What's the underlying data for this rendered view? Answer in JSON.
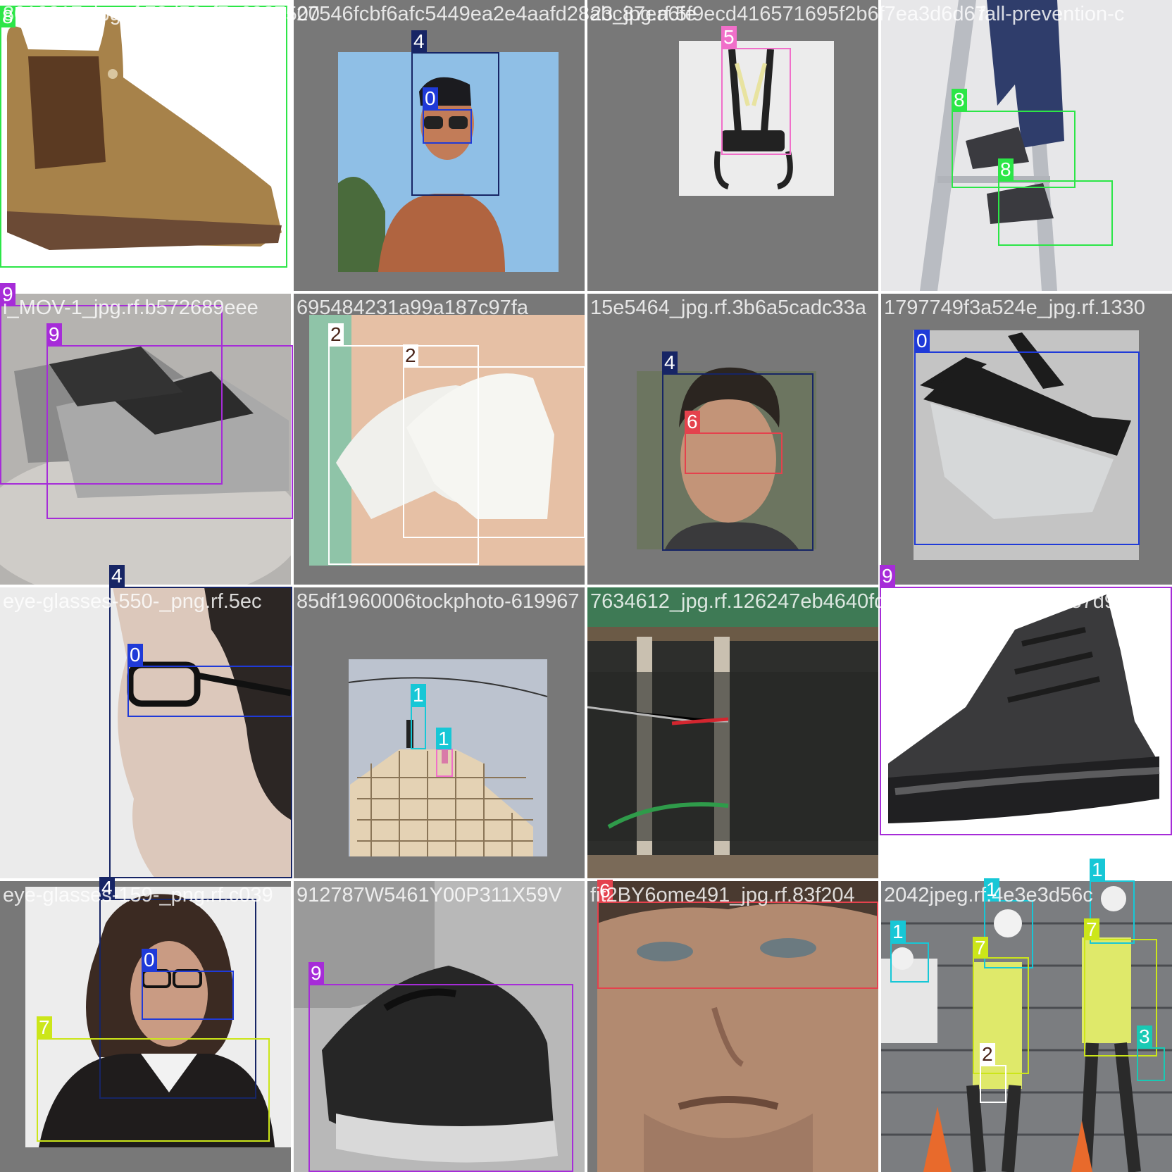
{
  "colors": {
    "0": "#1f3ad8",
    "1": "#17c7d6",
    "2": "#ffffff",
    "3": "#19c9b4",
    "4": "#172565",
    "5": "#f06fc9",
    "6": "#e4424d",
    "7": "#cce619",
    "8": "#2ce647",
    "9": "#a62cd8"
  },
  "tiles": [
    {
      "filename": "8010817_jpg.rf.72d56cf7e6927500",
      "subject": "brown-chelsea-boot",
      "boxes": [
        {
          "cls": "8"
        }
      ]
    },
    {
      "filename": "27546fcbf6afc5449ea2e4aafd28abc87ea6fe",
      "subject": "man-with-sunglasses",
      "boxes": [
        {
          "cls": "4"
        },
        {
          "cls": "0"
        }
      ]
    },
    {
      "filename": "23_jpg.rf.5f9ecd416571695f2b6f7ea3d6d67",
      "subject": "safety-harness",
      "boxes": [
        {
          "cls": "5"
        }
      ]
    },
    {
      "filename": "fall-prevention-c",
      "subject": "worker-on-ladder",
      "boxes": [
        {
          "cls": "8"
        },
        {
          "cls": "8"
        }
      ]
    },
    {
      "filename": "i_MOV-1_jpg.rf.b572689eee",
      "subject": "grey-sneakers",
      "boxes": [
        {
          "cls": "9"
        },
        {
          "cls": "9"
        }
      ]
    },
    {
      "filename": "695484231a99a187c97fa",
      "subject": "white-gloves",
      "boxes": [
        {
          "cls": "2"
        },
        {
          "cls": "2"
        }
      ]
    },
    {
      "filename": "15e5464_jpg.rf.3b6a5cadc33a",
      "subject": "smiling-man-face",
      "boxes": [
        {
          "cls": "4"
        },
        {
          "cls": "6"
        }
      ]
    },
    {
      "filename": "1797749f3a524e_jpg.rf.1330",
      "subject": "safety-goggles",
      "boxes": [
        {
          "cls": "0"
        }
      ]
    },
    {
      "filename": "eye-glasses-550-_png.rf.5ec",
      "subject": "woman-with-glasses",
      "boxes": [
        {
          "cls": "4"
        },
        {
          "cls": "0"
        }
      ]
    },
    {
      "filename": "85df1960006tockphoto-619967",
      "subject": "construction-frame",
      "boxes": [
        {
          "cls": "1"
        },
        {
          "cls": "1"
        }
      ]
    },
    {
      "filename": "7634612_jpg.rf.126247eb4640fd",
      "subject": "scaffold-net",
      "boxes": []
    },
    {
      "filename": "48533351jpg55d44987d909",
      "subject": "black-glitter-sneaker",
      "boxes": [
        {
          "cls": "9"
        }
      ]
    },
    {
      "filename": "eye-glasses-159-_png.rf.c039",
      "subject": "curly-hair-woman",
      "boxes": [
        {
          "cls": "4"
        },
        {
          "cls": "0"
        },
        {
          "cls": "7"
        }
      ]
    },
    {
      "filename": "912787W5461Y00P311X59V",
      "subject": "black-running-shoe",
      "boxes": [
        {
          "cls": "9"
        }
      ]
    },
    {
      "filename": "fit2BY6ome491_jpg.rf.83f204",
      "subject": "man-face-closeup",
      "boxes": [
        {
          "cls": "6"
        }
      ]
    },
    {
      "filename": "2042jpeg.rf.4e3e3d56c",
      "subject": "construction-workers",
      "boxes": [
        {
          "cls": "1"
        },
        {
          "cls": "1"
        },
        {
          "cls": "1"
        },
        {
          "cls": "7"
        },
        {
          "cls": "7"
        },
        {
          "cls": "3"
        },
        {
          "cls": "2"
        }
      ]
    }
  ]
}
